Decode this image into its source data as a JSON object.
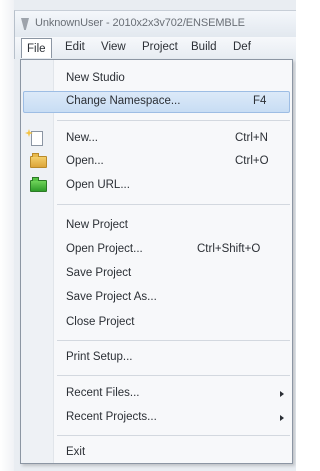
{
  "window": {
    "title": "UnknownUser - 2010x2x3v702/ENSEMBLE"
  },
  "menubar": {
    "items": [
      "File",
      "Edit",
      "View",
      "Project",
      "Build",
      "Def"
    ]
  },
  "file_menu": {
    "new_studio": "New Studio",
    "change_namespace": "Change Namespace...",
    "change_namespace_shortcut": "F4",
    "new": "New...",
    "new_shortcut": "Ctrl+N",
    "open": "Open...",
    "open_shortcut": "Ctrl+O",
    "open_url": "Open URL...",
    "new_project": "New Project",
    "open_project": "Open Project...",
    "open_project_shortcut": "Ctrl+Shift+O",
    "save_project": "Save Project",
    "save_project_as": "Save Project As...",
    "close_project": "Close Project",
    "print_setup": "Print Setup...",
    "recent_files": "Recent Files...",
    "recent_projects": "Recent Projects...",
    "exit": "Exit",
    "highlighted_item": "Change Namespace...",
    "highlight_color": "#c8ddf4"
  }
}
